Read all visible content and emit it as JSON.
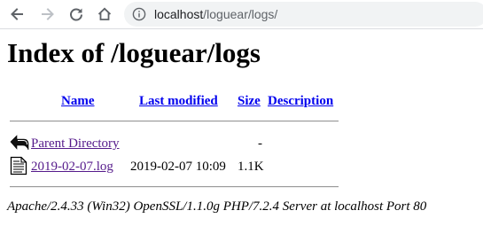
{
  "browser": {
    "url_host": "localhost",
    "url_path": "/loguear/logs/"
  },
  "page": {
    "title": "Index of /loguear/logs",
    "columns": {
      "name": "Name",
      "last_modified": "Last modified",
      "size": "Size",
      "description": "Description"
    },
    "rows": [
      {
        "name": "Parent Directory",
        "last_modified": "",
        "size": "-",
        "description": "",
        "icon": "back-folder-icon"
      },
      {
        "name": "2019-02-07.log",
        "last_modified": "2019-02-07 10:09",
        "size": "1.1K",
        "description": "",
        "icon": "text-file-icon"
      }
    ],
    "footer": "Apache/2.4.33 (Win32) OpenSSL/1.1.0g PHP/7.2.4 Server at localhost Port 80"
  },
  "colors": {
    "link": "#0000ee",
    "visited_link": "#551a8b",
    "omnibox_bg": "#f1f3f4"
  }
}
